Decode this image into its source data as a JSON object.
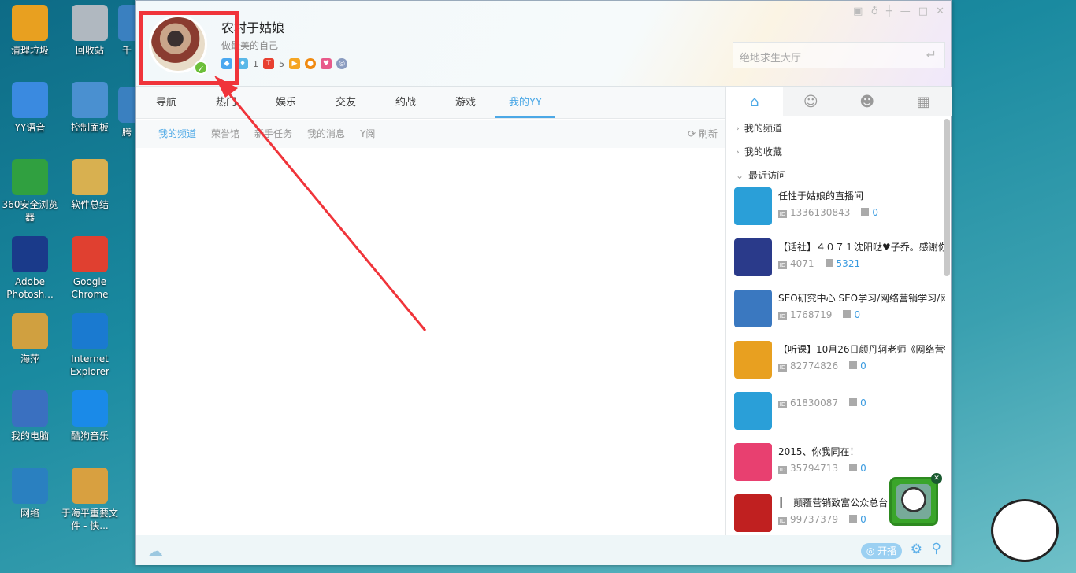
{
  "desktop": {
    "col1": [
      "清理垃圾",
      "YY语音",
      "360安全浏览器",
      "Adobe Photosh...",
      "海萍",
      "我的电脑",
      "网络"
    ],
    "col2": [
      "回收站",
      "控制面板",
      "软件总结",
      "Google Chrome",
      "Internet Explorer",
      "酷狗音乐",
      "于海平重要文件 - 快..."
    ],
    "col3": [
      "千",
      "腾"
    ]
  },
  "profile": {
    "name": "农村于姑娘",
    "signature": "做最美的自己",
    "badge1_count": "1",
    "badge2_count": "5"
  },
  "search": {
    "placeholder": "绝地求生大厅"
  },
  "nav": [
    "导航",
    "热门",
    "娱乐",
    "交友",
    "约战",
    "游戏",
    "我的YY"
  ],
  "subnav": [
    "我的频道",
    "荣誉馆",
    "新手任务",
    "我的消息",
    "Y阅"
  ],
  "refresh": "刷新",
  "tree": [
    "我的频道",
    "我的收藏",
    "最近访问"
  ],
  "recent": [
    {
      "title": "任性于姑娘的直播间",
      "id": "1336130843",
      "count": "0",
      "thumb": "#2a9fd8"
    },
    {
      "title": "【话社】４０７１沈阳哒♥子乔。感谢你",
      "id": "4071",
      "count": "5321",
      "thumb": "#2a3a8a"
    },
    {
      "title": "SEO研究中心 SEO学习/网络营销学习/网",
      "id": "1768719",
      "count": "0",
      "thumb": "#3a78c0"
    },
    {
      "title": "【听课】10月26日颜丹轲老师《网络营销",
      "id": "82774826",
      "count": "0",
      "thumb": "#e8a020"
    },
    {
      "title": "",
      "id": "61830087",
      "count": "0",
      "thumb": "#2a9fd8"
    },
    {
      "title": "2015、你我同在！",
      "id": "35794713",
      "count": "0",
      "thumb": "#e84070"
    },
    {
      "title": "┃　颠覆营销致富公众总台",
      "id": "99737379",
      "count": "0",
      "thumb": "#c02020"
    }
  ],
  "bottom": {
    "broadcast": "开播"
  },
  "colors": {
    "accent": "#4ba8e6",
    "annotation": "#f0343a"
  }
}
